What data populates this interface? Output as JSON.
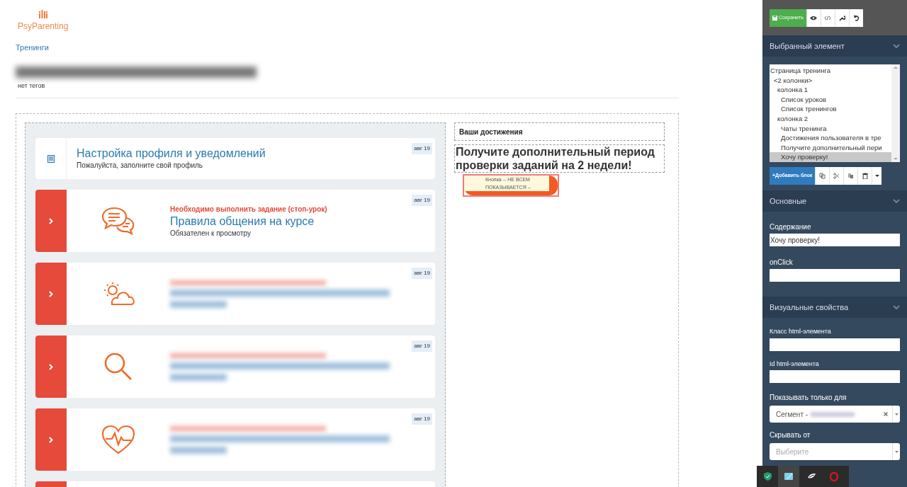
{
  "logo": {
    "text": "PsyParenting"
  },
  "breadcrumb": "Тренинги",
  "page": {
    "tags": "нет тегов"
  },
  "lessons": [
    {
      "kind": "text",
      "locked": false,
      "title": "Настройка профиля и уведомлений",
      "subtitle": "Пожалуйста, заполните свой профиль",
      "date": "авг 19"
    },
    {
      "kind": "text",
      "locked": true,
      "warning": "Необходимо выполнить задание (стоп-урок)",
      "title": "Правила общения на курсе",
      "subtitle": "Обязателен к просмотру",
      "date": "авг 19"
    },
    {
      "kind": "blurred",
      "locked": true,
      "date": "авг 19"
    },
    {
      "kind": "blurred",
      "locked": true,
      "date": "авг 19"
    },
    {
      "kind": "blurred",
      "locked": true,
      "date": "авг 19"
    },
    {
      "kind": "cut_off",
      "locked": true
    }
  ],
  "achievements": {
    "title": "Ваши достижения",
    "headline": "Получите дополнительный период проверки заданий на 2 недели!",
    "button_label": "Кнопка -- НЕ ВСЕМ ПОКАЗЫВАЕТСЯ --"
  },
  "editor": {
    "save": "Сохранить",
    "selected_section": "Выбранный элемент",
    "tree": [
      {
        "label": "Страница тренинга",
        "selected": false,
        "children": [
          {
            "label": "<2 колонки>",
            "selected": false,
            "children": [
              {
                "label": "колонка 1",
                "selected": false,
                "children": [
                  {
                    "label": "Список уроков",
                    "selected": false
                  },
                  {
                    "label": "Список тренингов",
                    "selected": false
                  }
                ]
              },
              {
                "label": "колонка 2",
                "selected": false,
                "children": [
                  {
                    "label": "Чаты тренинга",
                    "selected": false
                  },
                  {
                    "label": "Достижения пользователя в тре",
                    "selected": false
                  },
                  {
                    "label": "Получите дополнительный пери",
                    "selected": false
                  },
                  {
                    "label": "Хочу проверку!",
                    "selected": true
                  }
                ]
              }
            ]
          }
        ]
      }
    ],
    "add_block": "+Добавить блок",
    "basic_section": "Основные",
    "content_label": "Содержание",
    "content_value": "Хочу проверку!",
    "onclick_label": "onClick",
    "visual_section": "Визуальные свойства",
    "class_label": "Класс html-элемента",
    "id_label": "Id html-элемента",
    "show_label": "Показывать только для",
    "show_value": "Сегмент -",
    "hide_label": "Скрывать от",
    "hide_placeholder": "Выберите"
  }
}
